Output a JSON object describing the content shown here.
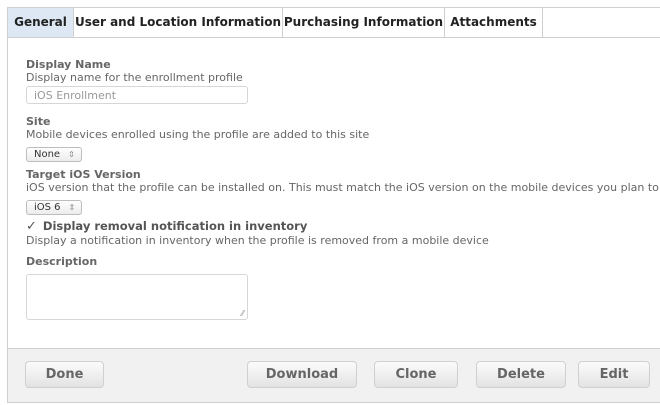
{
  "tabs": [
    {
      "label": "General",
      "active": true
    },
    {
      "label": "User and Location Information",
      "active": false
    },
    {
      "label": "Purchasing Information",
      "active": false
    },
    {
      "label": "Attachments",
      "active": false
    }
  ],
  "display_name": {
    "label": "Display Name",
    "hint": "Display name for the enrollment profile",
    "placeholder": "iOS Enrollment"
  },
  "site": {
    "label": "Site",
    "hint": "Mobile devices enrolled using the profile are added to this site",
    "selected": "None"
  },
  "target_ios": {
    "label": "Target iOS Version",
    "hint": "iOS version that the profile can be installed on. This must match the iOS version on the mobile devices you plan to enrol",
    "selected": "iOS 6"
  },
  "removal_notification": {
    "checked": true,
    "label": "Display removal notification in inventory",
    "hint": "Display a notification in inventory when the profile is removed from a mobile device"
  },
  "description": {
    "label": "Description",
    "value": ""
  },
  "footer": {
    "done": "Done",
    "download": "Download",
    "clone": "Clone",
    "delete": "Delete",
    "edit": "Edit"
  },
  "icons": {
    "select_arrow": "up-down-arrows-icon",
    "checkbox": "checkmark-icon",
    "resize": "resize-grip-icon"
  },
  "colors": {
    "active_tab": "#dde8f4",
    "footer_bg": "#f1f1f1",
    "border": "#cfcfcf"
  }
}
